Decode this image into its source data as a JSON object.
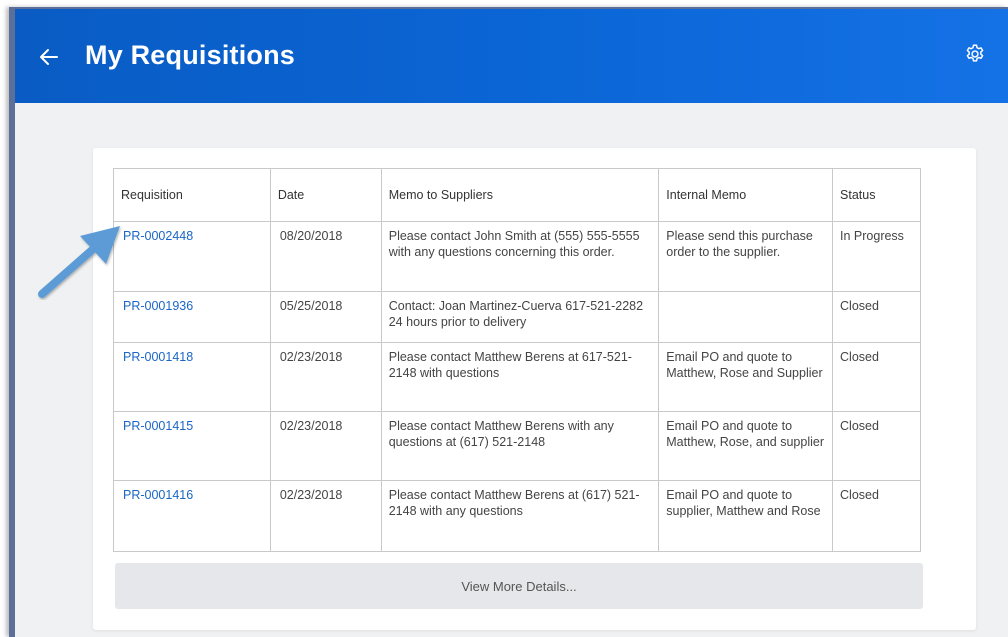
{
  "header": {
    "title": "My Requisitions",
    "back_icon": "arrow-left-icon",
    "settings_icon": "gear-icon"
  },
  "table": {
    "columns": [
      "Requisition",
      "Date",
      "Memo to Suppliers",
      "Internal Memo",
      "Status"
    ],
    "rows": [
      {
        "requisition": "PR-0002448",
        "date": "08/20/2018",
        "memo_to_suppliers": "Please contact John Smith at (555) 555-5555 with any questions concerning this order.",
        "internal_memo": "Please send this purchase order to the supplier.",
        "status": "In Progress"
      },
      {
        "requisition": "PR-0001936",
        "date": "05/25/2018",
        "memo_to_suppliers": "Contact:  Joan Martinez-Cuerva 617-521-2282 24 hours prior to delivery",
        "internal_memo": "",
        "status": "Closed"
      },
      {
        "requisition": "PR-0001418",
        "date": "02/23/2018",
        "memo_to_suppliers": "Please contact Matthew Berens at 617-521-2148 with questions",
        "internal_memo": "Email PO and quote to Matthew, Rose and Supplier",
        "status": "Closed"
      },
      {
        "requisition": "PR-0001415",
        "date": "02/23/2018",
        "memo_to_suppliers": "Please contact Matthew Berens with any questions at (617) 521-2148",
        "internal_memo": "Email PO and quote to Matthew, Rose, and supplier",
        "status": "Closed"
      },
      {
        "requisition": "PR-0001416",
        "date": "02/23/2018",
        "memo_to_suppliers": "Please contact Matthew Berens at (617) 521-2148 with any questions",
        "internal_memo": "Email PO and quote to supplier, Matthew and Rose",
        "status": "Closed"
      }
    ]
  },
  "more_button": {
    "label": "View More Details..."
  },
  "annotation": {
    "icon": "callout-arrow-icon",
    "color": "#5b9bd5"
  },
  "colors": {
    "header": "#0b66d6",
    "link": "#1a66c6"
  }
}
